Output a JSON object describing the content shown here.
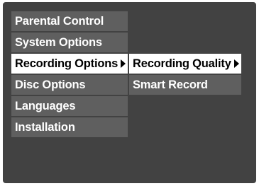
{
  "main_menu": {
    "items": [
      {
        "label": "Parental Control"
      },
      {
        "label": "System Options"
      },
      {
        "label": "Recording Options"
      },
      {
        "label": "Disc Options"
      },
      {
        "label": "Languages"
      },
      {
        "label": "Installation"
      }
    ],
    "selected_index": 2
  },
  "sub_menu": {
    "items": [
      {
        "label": "Recording Quality"
      },
      {
        "label": "Smart Record"
      }
    ],
    "selected_index": 0
  },
  "colors": {
    "screen_background": "#424242",
    "item_background": "#5f5f5f",
    "selected_background": "#ffffff",
    "item_text": "#ffffff",
    "selected_text": "#000000"
  }
}
